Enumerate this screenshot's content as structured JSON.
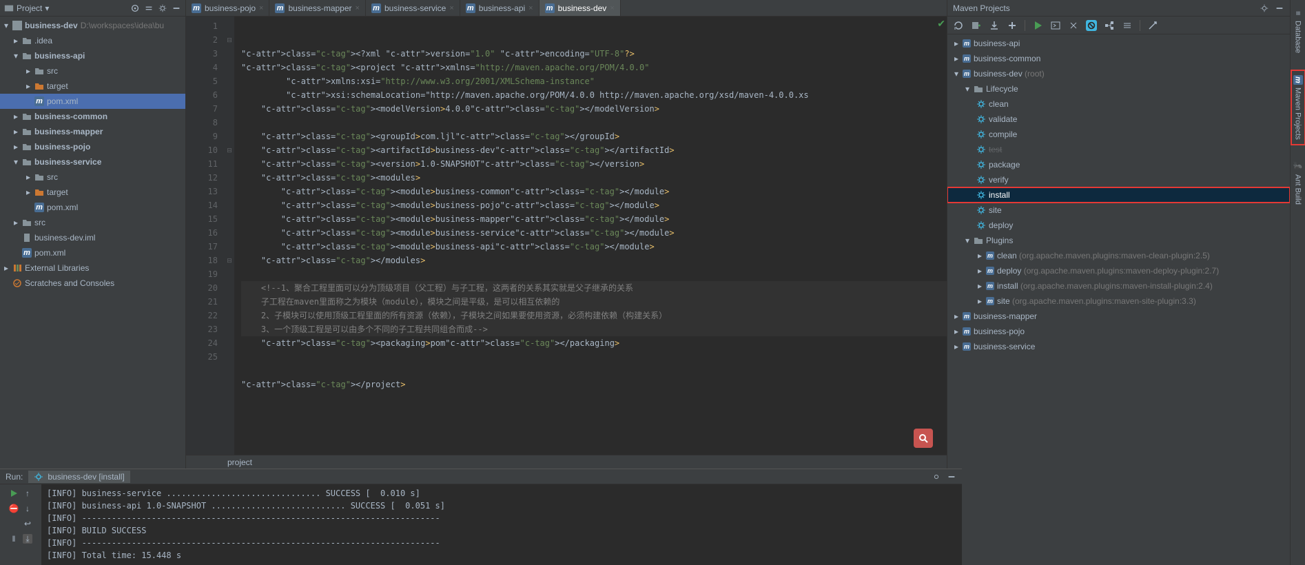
{
  "project_panel": {
    "title": "Project",
    "root": {
      "name": "business-dev",
      "path": "D:\\workspaces\\idea\\bu"
    },
    "nodes": [
      {
        "level": 1,
        "name": ".idea",
        "type": "folder"
      },
      {
        "level": 1,
        "name": "business-api",
        "type": "module-open",
        "bold": true
      },
      {
        "level": 2,
        "name": "src",
        "type": "folder"
      },
      {
        "level": 2,
        "name": "target",
        "type": "folder-orange"
      },
      {
        "level": 2,
        "name": "pom.xml",
        "type": "maven",
        "selected": true
      },
      {
        "level": 1,
        "name": "business-common",
        "type": "module",
        "bold": true
      },
      {
        "level": 1,
        "name": "business-mapper",
        "type": "module",
        "bold": true
      },
      {
        "level": 1,
        "name": "business-pojo",
        "type": "module",
        "bold": true
      },
      {
        "level": 1,
        "name": "business-service",
        "type": "module-open",
        "bold": true
      },
      {
        "level": 2,
        "name": "src",
        "type": "folder"
      },
      {
        "level": 2,
        "name": "target",
        "type": "folder-orange"
      },
      {
        "level": 2,
        "name": "pom.xml",
        "type": "maven"
      },
      {
        "level": 1,
        "name": "src",
        "type": "folder"
      },
      {
        "level": 1,
        "name": "business-dev.iml",
        "type": "file"
      },
      {
        "level": 1,
        "name": "pom.xml",
        "type": "maven"
      }
    ],
    "external_libs": "External Libraries",
    "scratches": "Scratches and Consoles"
  },
  "tabs": [
    {
      "label": "business-pojo"
    },
    {
      "label": "business-mapper"
    },
    {
      "label": "business-service"
    },
    {
      "label": "business-api"
    },
    {
      "label": "business-dev",
      "active": true
    }
  ],
  "editor": {
    "lines": [
      "<?xml version=\"1.0\" encoding=\"UTF-8\"?>",
      "<project xmlns=\"http://maven.apache.org/POM/4.0.0\"",
      "         xmlns:xsi=\"http://www.w3.org/2001/XMLSchema-instance\"",
      "         xsi:schemaLocation=\"http://maven.apache.org/POM/4.0.0 http://maven.apache.org/xsd/maven-4.0.0.xs",
      "    <modelVersion>4.0.0</modelVersion>",
      "",
      "    <groupId>com.ljl</groupId>",
      "    <artifactId>business-dev</artifactId>",
      "    <version>1.0-SNAPSHOT</version>",
      "    <modules>",
      "        <module>business-common</module>",
      "        <module>business-pojo</module>",
      "        <module>business-mapper</module>",
      "        <module>business-service</module>",
      "        <module>business-api</module>",
      "    </modules>",
      "",
      "    <!--1、聚合工程里面可以分为顶级项目（父工程）与子工程，这两者的关系其实就是父子继承的关系",
      "    子工程在maven里面称之为模块（module），模块之间是平级，是可以相互依赖的",
      "    2、子模块可以使用顶级工程里面的所有资源（依赖），子模块之间如果要使用资源，必须构建依赖（构建关系）",
      "    3、一个顶级工程是可以由多个不同的子工程共同组合而成-->",
      "    <packaging>pom</packaging>",
      "",
      "",
      "</project>"
    ],
    "breadcrumb": "project"
  },
  "maven": {
    "title": "Maven Projects",
    "roots": [
      {
        "name": "business-api"
      },
      {
        "name": "business-common"
      }
    ],
    "dev_root": {
      "name": "business-dev",
      "suffix": "(root)"
    },
    "lifecycle_label": "Lifecycle",
    "lifecycle": [
      "clean",
      "validate",
      "compile",
      "test",
      "package",
      "verify",
      "install",
      "site",
      "deploy"
    ],
    "plugins_label": "Plugins",
    "plugins": [
      {
        "name": "clean",
        "detail": "(org.apache.maven.plugins:maven-clean-plugin:2.5)"
      },
      {
        "name": "deploy",
        "detail": "(org.apache.maven.plugins:maven-deploy-plugin:2.7)"
      },
      {
        "name": "install",
        "detail": "(org.apache.maven.plugins:maven-install-plugin:2.4)"
      },
      {
        "name": "site",
        "detail": "(org.apache.maven.plugins:maven-site-plugin:3.3)"
      }
    ],
    "tail": [
      "business-mapper",
      "business-pojo",
      "business-service"
    ]
  },
  "run": {
    "label": "Run:",
    "config": "business-dev [install]",
    "lines": [
      "[INFO] business-service ............................... SUCCESS [  0.010 s]",
      "[INFO] business-api 1.0-SNAPSHOT ........................... SUCCESS [  0.051 s]",
      "[INFO] ------------------------------------------------------------------------",
      "[INFO] BUILD SUCCESS",
      "[INFO] ------------------------------------------------------------------------",
      "[INFO] Total time: 15.448 s"
    ]
  },
  "right_strip": {
    "database": "Database",
    "maven": "Maven Projects",
    "ant": "Ant Build"
  }
}
